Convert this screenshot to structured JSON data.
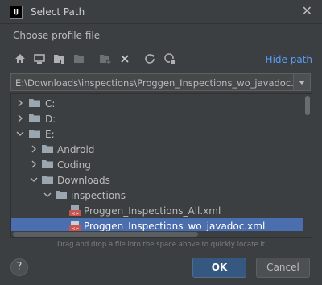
{
  "window": {
    "title": "Select Path",
    "app_icon_text": "IJ",
    "close_glyph": "✕"
  },
  "dialog": {
    "subtitle": "Choose profile file",
    "hide_path_label": "Hide path",
    "path_value": "E:\\Downloads\\inspections\\Proggen_Inspections_wo_javadoc.xml",
    "drag_hint": "Drag and drop a file into the space above to quickly locate it"
  },
  "toolbar": {
    "icons": [
      "home-icon",
      "desktop-icon",
      "project-folder-icon",
      "module-folder-icon",
      "new-folder-icon",
      "delete-icon",
      "refresh-icon",
      "show-hidden-icon"
    ]
  },
  "tree": {
    "items": [
      {
        "label": "C:",
        "type": "folder",
        "expanded": false
      },
      {
        "label": "D:",
        "type": "folder",
        "expanded": false
      },
      {
        "label": "E:",
        "type": "folder",
        "expanded": true
      },
      {
        "label": "Android",
        "type": "folder",
        "expanded": false
      },
      {
        "label": "Coding",
        "type": "folder",
        "expanded": false
      },
      {
        "label": "Downloads",
        "type": "folder",
        "expanded": true
      },
      {
        "label": "inspections",
        "type": "folder",
        "expanded": true
      },
      {
        "label": "Proggen_Inspections_All.xml",
        "type": "xml-file"
      },
      {
        "label": "Proggen_Inspections_wo_javadoc.xml",
        "type": "xml-file",
        "selected": true
      }
    ]
  },
  "buttons": {
    "help_label": "?",
    "ok_label": "OK",
    "cancel_label": "Cancel"
  },
  "colors": {
    "background": "#3c3f41",
    "selection": "#4b6eaf",
    "link": "#589df6",
    "folder": "#9aa7b0",
    "ok_button": "#365880"
  }
}
